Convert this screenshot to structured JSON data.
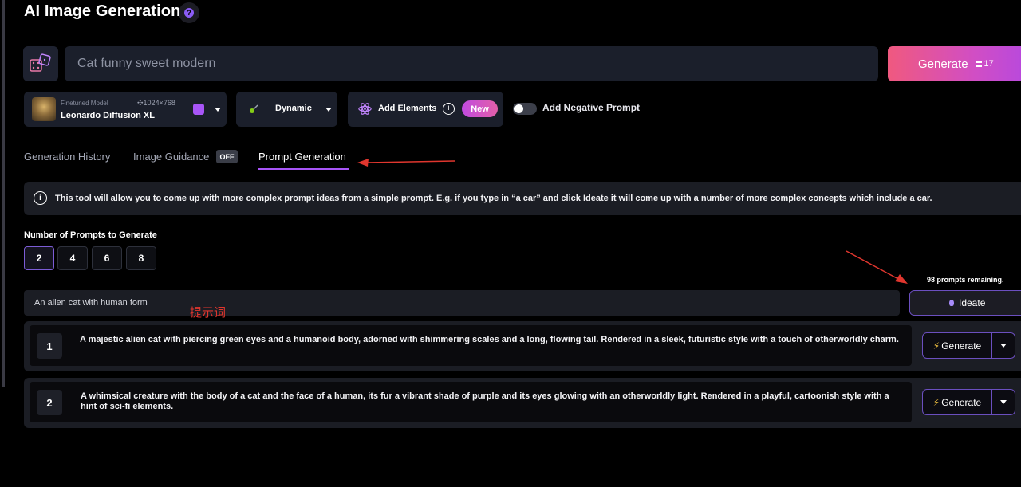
{
  "header": {
    "title": "AI Image Generation",
    "help_icon": "question-icon"
  },
  "prompt_bar": {
    "dice_icon": "dice-icon",
    "value": "Cat funny sweet modern",
    "generate_label": "Generate",
    "generate_cost": "17",
    "cost_icon": "token-icon"
  },
  "options": {
    "model": {
      "subtitle": "Finetuned Model",
      "resolution": "1024×768",
      "name": "Leonardo Diffusion XL"
    },
    "style": {
      "label": "Dynamic"
    },
    "elements": {
      "label": "Add Elements",
      "badge": "New"
    },
    "negative_prompt": {
      "label": "Add Negative Prompt",
      "enabled": false
    }
  },
  "tabs": [
    {
      "label": "Generation History"
    },
    {
      "label": "Image Guidance",
      "badge": "OFF"
    },
    {
      "label": "Prompt Generation",
      "active": true
    }
  ],
  "info": {
    "text": "This tool will allow you to come up with more complex prompt ideas from a simple prompt. E.g. if you type in “a car” and click Ideate it will come up with a number of more complex concepts which include a car."
  },
  "prompt_count": {
    "label": "Number of Prompts to Generate",
    "options": [
      "2",
      "4",
      "6",
      "8"
    ],
    "selected": "2"
  },
  "ideate": {
    "remaining": "98 prompts remaining.",
    "input_value": "An alien cat with human form",
    "annotation": "提示词",
    "button_label": "Ideate"
  },
  "results": [
    {
      "num": "1",
      "text": "A majestic alien cat with piercing green eyes and a humanoid body, adorned with shimmering scales and a long, flowing tail. Rendered in a sleek, futuristic style with a touch of otherworldly charm.",
      "button_label": "Generate"
    },
    {
      "num": "2",
      "text": "A whimsical creature with the body of a cat and the face of a human, its fur a vibrant shade of purple and its eyes glowing with an otherworldly light. Rendered in a playful, cartoonish style with a hint of sci-fi elements.",
      "button_label": "Generate"
    }
  ],
  "colors": {
    "accent": "#a855f7",
    "generate_gradient_start": "#f0597f",
    "generate_gradient_end": "#b548e0",
    "annotation": "#e0362e"
  }
}
